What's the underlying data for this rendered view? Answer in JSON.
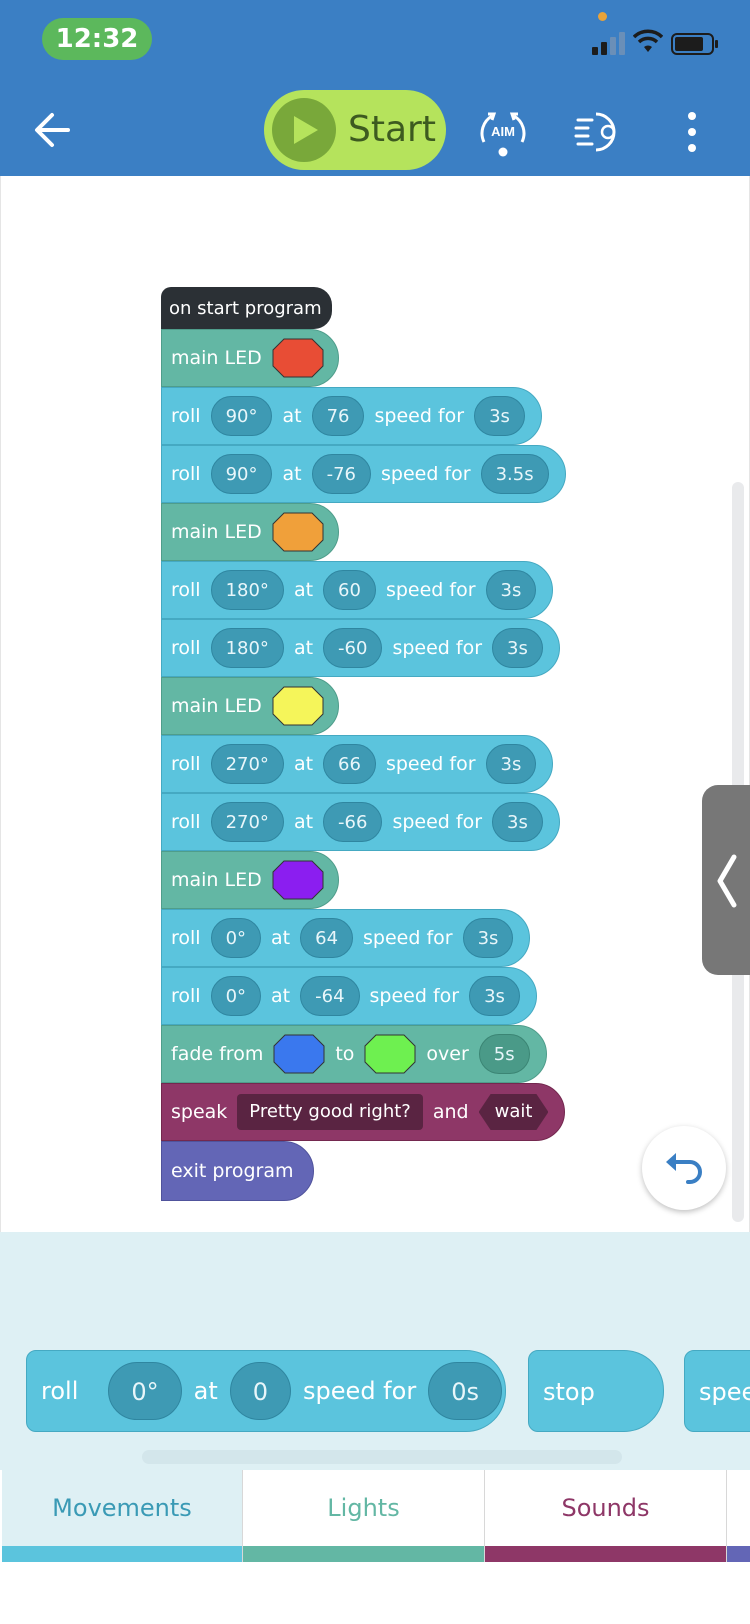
{
  "status_bar": {
    "time": "12:32"
  },
  "header": {
    "start_label": "Start",
    "aim_label": "AIM"
  },
  "program": {
    "event_label": "on start program",
    "led_label": "main LED",
    "roll_word": "roll",
    "at_word": "at",
    "speed_for_word": "speed for",
    "blocks": [
      {
        "type": "led",
        "color": "#e84d35"
      },
      {
        "type": "roll",
        "heading": "90°",
        "speed": "76",
        "duration": "3s"
      },
      {
        "type": "roll",
        "heading": "90°",
        "speed": "-76",
        "duration": "3.5s"
      },
      {
        "type": "led",
        "color": "#f0a03a"
      },
      {
        "type": "roll",
        "heading": "180°",
        "speed": "60",
        "duration": "3s"
      },
      {
        "type": "roll",
        "heading": "180°",
        "speed": "-60",
        "duration": "3s"
      },
      {
        "type": "led",
        "color": "#f5f55a"
      },
      {
        "type": "roll",
        "heading": "270°",
        "speed": "66",
        "duration": "3s"
      },
      {
        "type": "roll",
        "heading": "270°",
        "speed": "-66",
        "duration": "3s"
      },
      {
        "type": "led",
        "color": "#8b1ef0"
      },
      {
        "type": "roll",
        "heading": "0°",
        "speed": "64",
        "duration": "3s"
      },
      {
        "type": "roll",
        "heading": "0°",
        "speed": "-64",
        "duration": "3s"
      }
    ],
    "fade": {
      "from_word": "fade from",
      "to_word": "to",
      "over_word": "over",
      "from_color": "#3a78ee",
      "to_color": "#6ef050",
      "duration": "5s"
    },
    "speak": {
      "speak_word": "speak",
      "text": "Pretty good right?",
      "and_word": "and",
      "wait_word": "wait"
    },
    "exit_label": "exit program"
  },
  "palette": {
    "roll": {
      "roll_word": "roll",
      "heading": "0°",
      "at_word": "at",
      "speed": "0",
      "speed_for_word": "speed for",
      "duration": "0s"
    },
    "stop_label": "stop",
    "speed_label": "spee"
  },
  "tabs": [
    {
      "label": "Movements",
      "text_color": "#3a9ab5",
      "bar_color": "#5bc4dd",
      "bg": "#def0f4"
    },
    {
      "label": "Lights",
      "text_color": "#63b7a4",
      "bar_color": "#63b7a4",
      "bg": "#ffffff"
    },
    {
      "label": "Sounds",
      "text_color": "#8e3767",
      "bar_color": "#8e3767",
      "bg": "#ffffff"
    }
  ]
}
